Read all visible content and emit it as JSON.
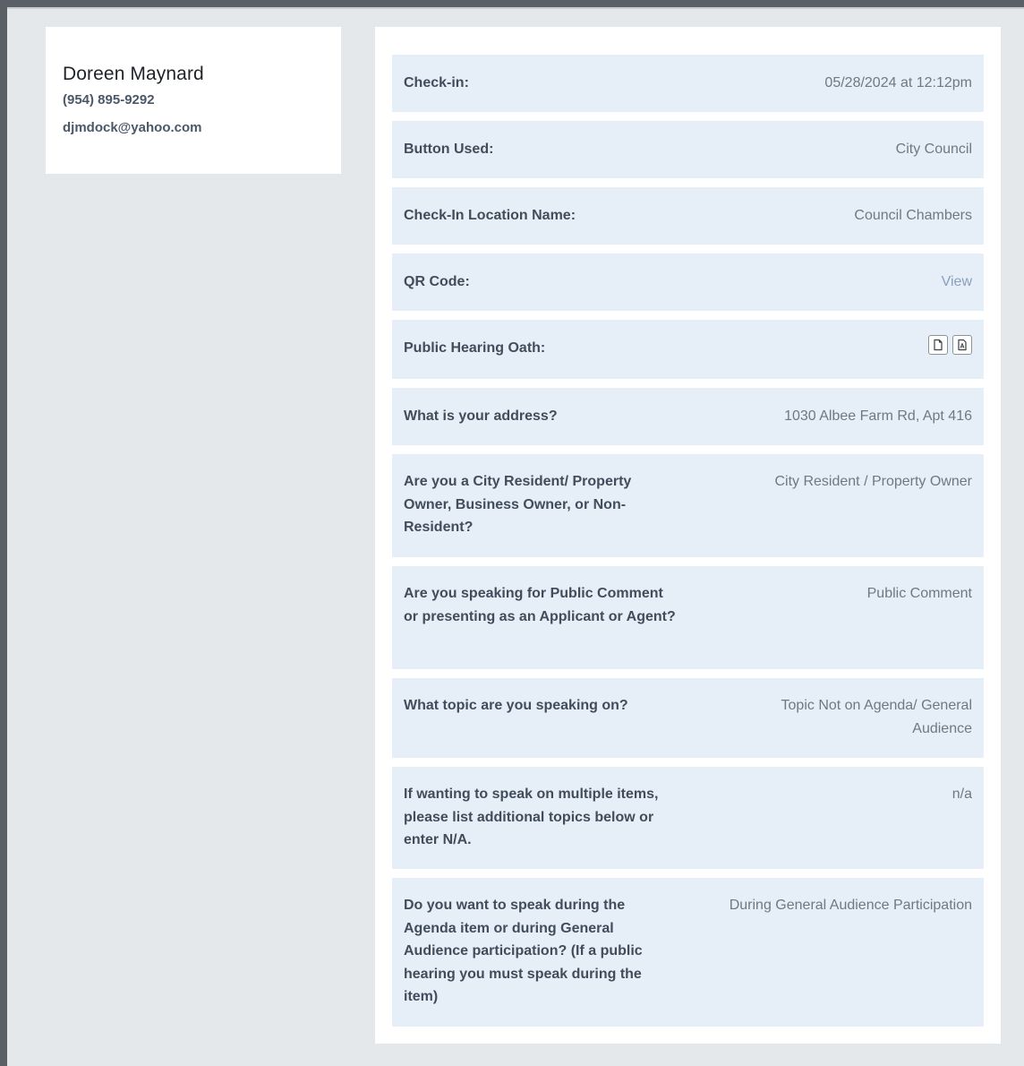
{
  "contact": {
    "name": "Doreen Maynard",
    "phone": "(954) 895-9292",
    "email": "djmdock@yahoo.com"
  },
  "details": {
    "checkin": {
      "label": "Check-in:",
      "value": "05/28/2024 at 12:12pm"
    },
    "button_used": {
      "label": "Button Used:",
      "value": "City Council"
    },
    "location": {
      "label": "Check-In Location Name:",
      "value": "Council Chambers"
    },
    "qr_code": {
      "label": "QR Code:",
      "value": "View"
    },
    "oath": {
      "label": "Public Hearing Oath:",
      "icons": [
        "document-icon",
        "pdf-icon"
      ]
    },
    "address": {
      "label": "What is your address?",
      "value": "1030 Albee Farm Rd, Apt 416"
    },
    "residency": {
      "label": "Are you a City Resident/ Property Owner, Business Owner, or Non-Resident?",
      "value": "City Resident / Property Owner"
    },
    "speaking_role": {
      "label": "Are you speaking for Public Comment or presenting as an Applicant or Agent?",
      "value": "Public Comment"
    },
    "topic": {
      "label": "What topic are you speaking on?",
      "value": "Topic Not on Agenda/ General Audience"
    },
    "additional_topics": {
      "label": "If wanting to speak on multiple items, please list additional topics below or enter N/A.",
      "value": "n/a"
    },
    "timing": {
      "label": "Do you want to speak during the Agenda item or during General Audience participation? (If a public hearing you must speak during the item)",
      "value": "During General Audience Participation"
    }
  }
}
